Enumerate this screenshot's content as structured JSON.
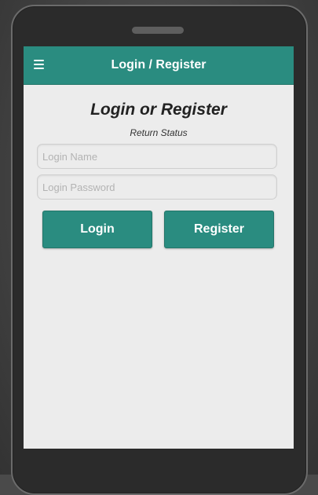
{
  "header": {
    "title": "Login / Register",
    "menu_icon": "menu-icon"
  },
  "main": {
    "title": "Login or Register",
    "status": "Return Status",
    "login_name": {
      "value": "",
      "placeholder": "Login Name"
    },
    "login_password": {
      "value": "",
      "placeholder": "Login Password"
    },
    "buttons": {
      "login": "Login",
      "register": "Register"
    }
  },
  "colors": {
    "accent": "#2a8c80",
    "screen_bg": "#ececec",
    "phone_body": "#2b2b2b"
  }
}
